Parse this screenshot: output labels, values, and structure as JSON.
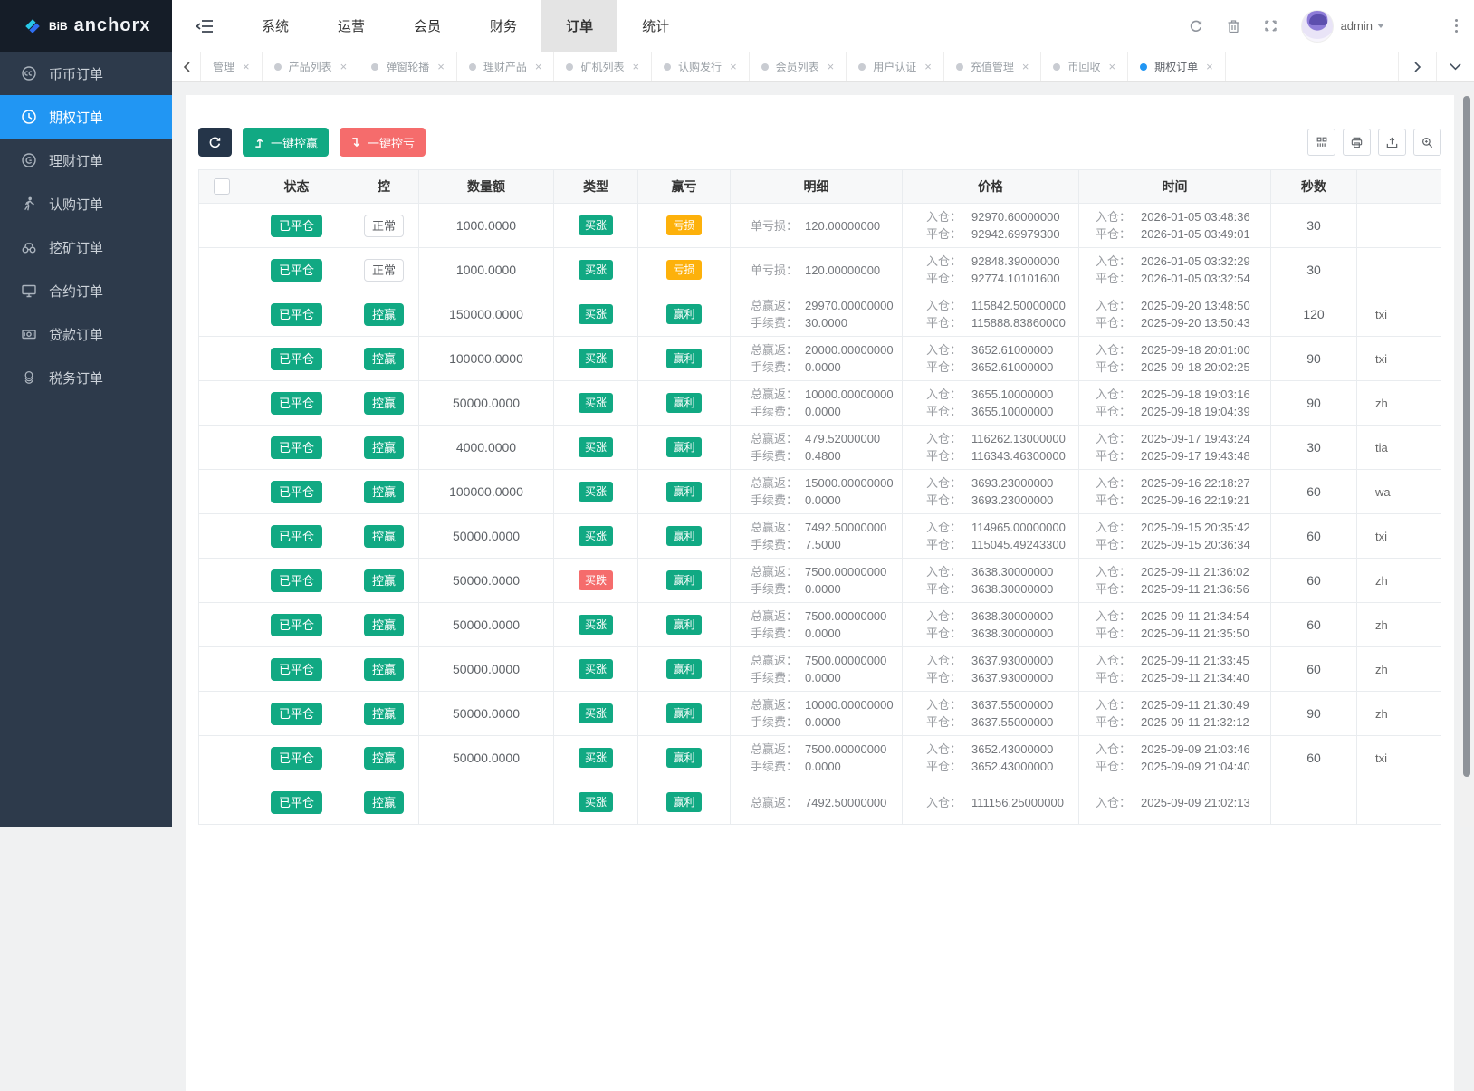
{
  "header": {
    "logo": {
      "small": "BiB",
      "brand": "anchorx"
    },
    "menu": [
      {
        "label": "系统",
        "active": false
      },
      {
        "label": "运营",
        "active": false
      },
      {
        "label": "会员",
        "active": false
      },
      {
        "label": "财务",
        "active": false
      },
      {
        "label": "订单",
        "active": true
      },
      {
        "label": "统计",
        "active": false
      }
    ],
    "user": "admin"
  },
  "icons": {
    "close": "×"
  },
  "tabs": [
    {
      "label": "管理",
      "dot": false,
      "active": false
    },
    {
      "label": "产品列表",
      "dot": true,
      "active": false
    },
    {
      "label": "弹窗轮播",
      "dot": true,
      "active": false
    },
    {
      "label": "理财产品",
      "dot": true,
      "active": false
    },
    {
      "label": "矿机列表",
      "dot": true,
      "active": false
    },
    {
      "label": "认购发行",
      "dot": true,
      "active": false
    },
    {
      "label": "会员列表",
      "dot": true,
      "active": false
    },
    {
      "label": "用户认证",
      "dot": true,
      "active": false
    },
    {
      "label": "充值管理",
      "dot": true,
      "active": false
    },
    {
      "label": "币回收",
      "dot": true,
      "active": false
    },
    {
      "label": "期权订单",
      "dot": true,
      "active": true
    }
  ],
  "sidebar": [
    {
      "label": "币币订单",
      "icon": "coin-pair-icon",
      "active": false
    },
    {
      "label": "期权订单",
      "icon": "clock-icon",
      "active": true
    },
    {
      "label": "理财订单",
      "icon": "finance-icon",
      "active": false
    },
    {
      "label": "认购订单",
      "icon": "person-icon",
      "active": false
    },
    {
      "label": "挖矿订单",
      "icon": "binoculars-icon",
      "active": false
    },
    {
      "label": "合约订单",
      "icon": "monitor-icon",
      "active": false
    },
    {
      "label": "贷款订单",
      "icon": "money-icon",
      "active": false
    },
    {
      "label": "税务订单",
      "icon": "coins-icon",
      "active": false
    }
  ],
  "toolbar": {
    "win_button": "一键控赢",
    "lose_button": "一键控亏"
  },
  "table": {
    "columns": [
      "状态",
      "控",
      "数量额",
      "类型",
      "赢亏",
      "明细",
      "价格",
      "时间",
      "秒数",
      ""
    ],
    "labels": {
      "entry": "入仓：",
      "close": "平仓："
    },
    "rows": [
      {
        "status": "已平仓",
        "control": "正常",
        "control_style": "plain",
        "amount": "1000.0000",
        "type": "买涨",
        "type_style": "green",
        "result": "亏损",
        "result_style": "yellow",
        "detail": [
          [
            "单亏损：",
            "120.00000000"
          ]
        ],
        "price_entry": "92970.60000000",
        "price_close": "92942.69979300",
        "time_entry": "2026-01-05 03:48:36",
        "time_close": "2026-01-05 03:49:01",
        "seconds": "30",
        "member": ""
      },
      {
        "status": "已平仓",
        "control": "正常",
        "control_style": "plain",
        "amount": "1000.0000",
        "type": "买涨",
        "type_style": "green",
        "result": "亏损",
        "result_style": "yellow",
        "detail": [
          [
            "单亏损：",
            "120.00000000"
          ]
        ],
        "price_entry": "92848.39000000",
        "price_close": "92774.10101600",
        "time_entry": "2026-01-05 03:32:29",
        "time_close": "2026-01-05 03:32:54",
        "seconds": "30",
        "member": ""
      },
      {
        "status": "已平仓",
        "control": "控赢",
        "control_style": "green",
        "amount": "150000.0000",
        "type": "买涨",
        "type_style": "green",
        "result": "赢利",
        "result_style": "green",
        "detail": [
          [
            "总赢返：",
            "29970.00000000"
          ],
          [
            "手续费：",
            "30.0000"
          ]
        ],
        "price_entry": "115842.50000000",
        "price_close": "115888.83860000",
        "time_entry": "2025-09-20 13:48:50",
        "time_close": "2025-09-20 13:50:43",
        "seconds": "120",
        "member": "txi"
      },
      {
        "status": "已平仓",
        "control": "控赢",
        "control_style": "green",
        "amount": "100000.0000",
        "type": "买涨",
        "type_style": "green",
        "result": "赢利",
        "result_style": "green",
        "detail": [
          [
            "总赢返：",
            "20000.00000000"
          ],
          [
            "手续费：",
            "0.0000"
          ]
        ],
        "price_entry": "3652.61000000",
        "price_close": "3652.61000000",
        "time_entry": "2025-09-18 20:01:00",
        "time_close": "2025-09-18 20:02:25",
        "seconds": "90",
        "member": "txi"
      },
      {
        "status": "已平仓",
        "control": "控赢",
        "control_style": "green",
        "amount": "50000.0000",
        "type": "买涨",
        "type_style": "green",
        "result": "赢利",
        "result_style": "green",
        "detail": [
          [
            "总赢返：",
            "10000.00000000"
          ],
          [
            "手续费：",
            "0.0000"
          ]
        ],
        "price_entry": "3655.10000000",
        "price_close": "3655.10000000",
        "time_entry": "2025-09-18 19:03:16",
        "time_close": "2025-09-18 19:04:39",
        "seconds": "90",
        "member": "zh"
      },
      {
        "status": "已平仓",
        "control": "控赢",
        "control_style": "green",
        "amount": "4000.0000",
        "type": "买涨",
        "type_style": "green",
        "result": "赢利",
        "result_style": "green",
        "detail": [
          [
            "总赢返：",
            "479.52000000"
          ],
          [
            "手续费：",
            "0.4800"
          ]
        ],
        "price_entry": "116262.13000000",
        "price_close": "116343.46300000",
        "time_entry": "2025-09-17 19:43:24",
        "time_close": "2025-09-17 19:43:48",
        "seconds": "30",
        "member": "tia"
      },
      {
        "status": "已平仓",
        "control": "控赢",
        "control_style": "green",
        "amount": "100000.0000",
        "type": "买涨",
        "type_style": "green",
        "result": "赢利",
        "result_style": "green",
        "detail": [
          [
            "总赢返：",
            "15000.00000000"
          ],
          [
            "手续费：",
            "0.0000"
          ]
        ],
        "price_entry": "3693.23000000",
        "price_close": "3693.23000000",
        "time_entry": "2025-09-16 22:18:27",
        "time_close": "2025-09-16 22:19:21",
        "seconds": "60",
        "member": "wa"
      },
      {
        "status": "已平仓",
        "control": "控赢",
        "control_style": "green",
        "amount": "50000.0000",
        "type": "买涨",
        "type_style": "green",
        "result": "赢利",
        "result_style": "green",
        "detail": [
          [
            "总赢返：",
            "7492.50000000"
          ],
          [
            "手续费：",
            "7.5000"
          ]
        ],
        "price_entry": "114965.00000000",
        "price_close": "115045.49243300",
        "time_entry": "2025-09-15 20:35:42",
        "time_close": "2025-09-15 20:36:34",
        "seconds": "60",
        "member": "txi"
      },
      {
        "status": "已平仓",
        "control": "控赢",
        "control_style": "green",
        "amount": "50000.0000",
        "type": "买跌",
        "type_style": "red",
        "result": "赢利",
        "result_style": "green",
        "detail": [
          [
            "总赢返：",
            "7500.00000000"
          ],
          [
            "手续费：",
            "0.0000"
          ]
        ],
        "price_entry": "3638.30000000",
        "price_close": "3638.30000000",
        "time_entry": "2025-09-11 21:36:02",
        "time_close": "2025-09-11 21:36:56",
        "seconds": "60",
        "member": "zh"
      },
      {
        "status": "已平仓",
        "control": "控赢",
        "control_style": "green",
        "amount": "50000.0000",
        "type": "买涨",
        "type_style": "green",
        "result": "赢利",
        "result_style": "green",
        "detail": [
          [
            "总赢返：",
            "7500.00000000"
          ],
          [
            "手续费：",
            "0.0000"
          ]
        ],
        "price_entry": "3638.30000000",
        "price_close": "3638.30000000",
        "time_entry": "2025-09-11 21:34:54",
        "time_close": "2025-09-11 21:35:50",
        "seconds": "60",
        "member": "zh"
      },
      {
        "status": "已平仓",
        "control": "控赢",
        "control_style": "green",
        "amount": "50000.0000",
        "type": "买涨",
        "type_style": "green",
        "result": "赢利",
        "result_style": "green",
        "detail": [
          [
            "总赢返：",
            "7500.00000000"
          ],
          [
            "手续费：",
            "0.0000"
          ]
        ],
        "price_entry": "3637.93000000",
        "price_close": "3637.93000000",
        "time_entry": "2025-09-11 21:33:45",
        "time_close": "2025-09-11 21:34:40",
        "seconds": "60",
        "member": "zh"
      },
      {
        "status": "已平仓",
        "control": "控赢",
        "control_style": "green",
        "amount": "50000.0000",
        "type": "买涨",
        "type_style": "green",
        "result": "赢利",
        "result_style": "green",
        "detail": [
          [
            "总赢返：",
            "10000.00000000"
          ],
          [
            "手续费：",
            "0.0000"
          ]
        ],
        "price_entry": "3637.55000000",
        "price_close": "3637.55000000",
        "time_entry": "2025-09-11 21:30:49",
        "time_close": "2025-09-11 21:32:12",
        "seconds": "90",
        "member": "zh"
      },
      {
        "status": "已平仓",
        "control": "控赢",
        "control_style": "green",
        "amount": "50000.0000",
        "type": "买涨",
        "type_style": "green",
        "result": "赢利",
        "result_style": "green",
        "detail": [
          [
            "总赢返：",
            "7500.00000000"
          ],
          [
            "手续费：",
            "0.0000"
          ]
        ],
        "price_entry": "3652.43000000",
        "price_close": "3652.43000000",
        "time_entry": "2025-09-09 21:03:46",
        "time_close": "2025-09-09 21:04:40",
        "seconds": "60",
        "member": "txi"
      },
      {
        "status": "已平仓",
        "control": "控赢",
        "control_style": "green",
        "amount": "",
        "type": "买涨",
        "type_style": "green",
        "result": "赢利",
        "result_style": "green",
        "detail": [
          [
            "总赢返：",
            "7492.50000000"
          ]
        ],
        "price_entry": "111156.25000000",
        "price_close": "",
        "time_entry": "2025-09-09 21:02:13",
        "time_close": "",
        "seconds": "",
        "member": ""
      }
    ]
  },
  "colors": {
    "accent_green": "#11A983",
    "accent_red": "#F56C6C",
    "accent_yellow": "#FDB10B",
    "accent_blue": "#2196F3",
    "sidebar_bg": "#2D3A4B",
    "header_dark": "#151D28"
  }
}
